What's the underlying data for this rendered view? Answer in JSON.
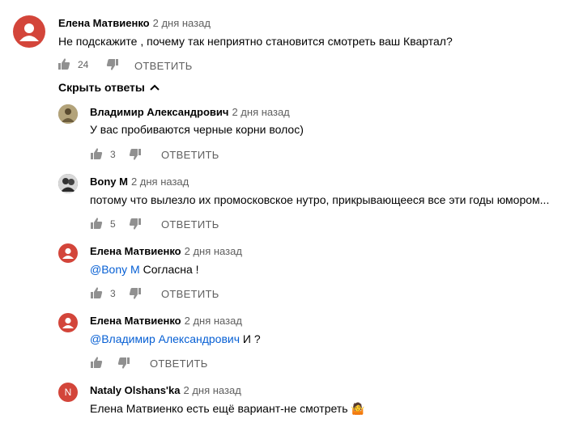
{
  "top_comment": {
    "author": "Елена Матвиенко",
    "time": "2 дня назад",
    "text": "Не подскажите , почему так неприятно становится смотреть ваш Квартал?",
    "likes": "24",
    "reply_label": "ОТВЕТИТЬ"
  },
  "toggle_label": "Скрыть ответы",
  "replies": [
    {
      "author": "Владимир Александрович",
      "time": "2 дня назад",
      "mention": "",
      "text": "У вас пробиваются черные корни волос)",
      "likes": "3",
      "reply_label": "ОТВЕТИТЬ"
    },
    {
      "author": "Bony M",
      "time": "2 дня назад",
      "mention": "",
      "text": "потому что  вылезло их промосковское нутро, прикрывающееся все эти годы юмором...",
      "likes": "5",
      "reply_label": "ОТВЕТИТЬ"
    },
    {
      "author": "Елена Матвиенко",
      "time": "2 дня назад",
      "mention": "@Bony M",
      "text": " Согласна !",
      "likes": "3",
      "reply_label": "ОТВЕТИТЬ"
    },
    {
      "author": "Елена Матвиенко",
      "time": "2 дня назад",
      "mention": "@Владимир Александрович",
      "text": " И ?",
      "likes": "",
      "reply_label": "ОТВЕТИТЬ"
    },
    {
      "author": "Nataly Olshans'ka",
      "time": "2 дня назад",
      "mention": "",
      "text": "Елена Матвиенко есть ещё вариант-не смотреть 🤷",
      "avatar_letter": "N"
    }
  ],
  "colors": {
    "avatar_red": "#d3453a",
    "link": "#065fd4",
    "muted": "#606060"
  }
}
